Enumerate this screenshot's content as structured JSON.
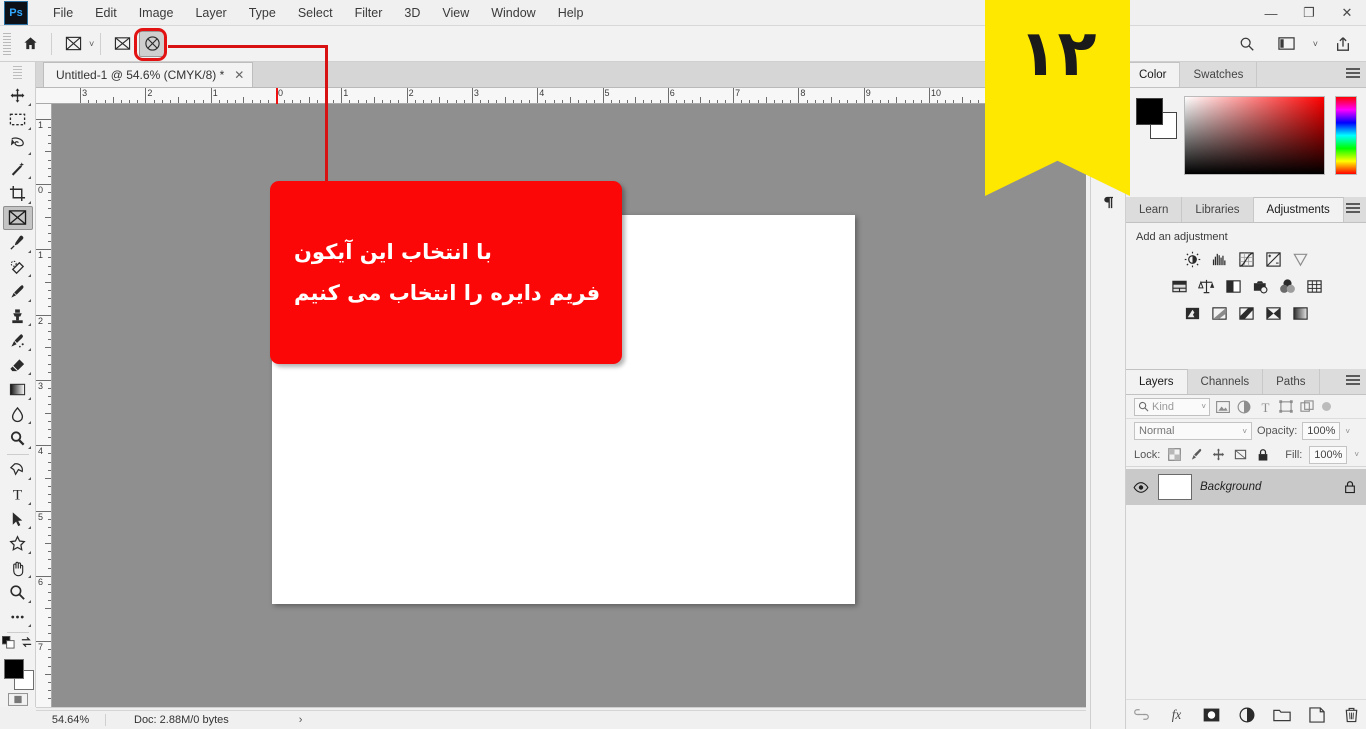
{
  "app": {
    "logo": "Ps",
    "menus": [
      "File",
      "Edit",
      "Image",
      "Layer",
      "Type",
      "Select",
      "Filter",
      "3D",
      "View",
      "Window",
      "Help"
    ],
    "window_controls": {
      "minimize": "—",
      "restore": "❐",
      "close": "✕"
    }
  },
  "options_bar": {
    "home_icon": "home-icon",
    "tool_preset_icon": "frame-tool-icon",
    "preset_caret": "˅",
    "rect_frame_icon": "rectangular-frame-icon",
    "ellipse_frame_icon": "elliptical-frame-icon",
    "search_icon": "search-icon",
    "workspace_icon": "workspace-icon",
    "workspace_caret": "˅",
    "share_icon": "share-icon"
  },
  "document_tab": {
    "title": "Untitled-1 @ 54.6% (CMYK/8) *",
    "close": "✕"
  },
  "toolbar": {
    "tools": [
      {
        "name": "move-tool",
        "glyph": "✥",
        "selected": false,
        "has_more": true
      },
      {
        "name": "marquee-tool",
        "glyph": "⬚",
        "selected": false,
        "has_more": true
      },
      {
        "name": "lasso-tool",
        "glyph": "➿",
        "selected": false,
        "has_more": true
      },
      {
        "name": "magic-wand-tool",
        "glyph": "✦",
        "selected": false,
        "has_more": true
      },
      {
        "name": "crop-tool",
        "glyph": "⌗",
        "selected": false,
        "has_more": true
      },
      {
        "name": "frame-tool",
        "glyph": "⌧",
        "selected": true,
        "has_more": false
      },
      {
        "name": "eyedropper-tool",
        "glyph": "✒",
        "selected": false,
        "has_more": true
      },
      {
        "name": "healing-brush-tool",
        "glyph": "⊘",
        "selected": false,
        "has_more": true
      },
      {
        "name": "brush-tool",
        "glyph": "✎",
        "selected": false,
        "has_more": true
      },
      {
        "name": "clone-stamp-tool",
        "glyph": "⚒",
        "selected": false,
        "has_more": true
      },
      {
        "name": "history-brush-tool",
        "glyph": "✐",
        "selected": false,
        "has_more": true
      },
      {
        "name": "eraser-tool",
        "glyph": "◰",
        "selected": false,
        "has_more": true
      },
      {
        "name": "gradient-tool",
        "glyph": "▤",
        "selected": false,
        "has_more": true
      },
      {
        "name": "blur-tool",
        "glyph": "○",
        "selected": false,
        "has_more": true
      },
      {
        "name": "dodge-tool",
        "glyph": "⚲",
        "selected": false,
        "has_more": true
      },
      {
        "name": "pen-tool",
        "glyph": "✒",
        "selected": false,
        "has_more": true
      },
      {
        "name": "type-tool",
        "glyph": "T",
        "selected": false,
        "has_more": true
      },
      {
        "name": "path-selection-tool",
        "glyph": "➤",
        "selected": false,
        "has_more": true
      },
      {
        "name": "shape-tool",
        "glyph": "★",
        "selected": false,
        "has_more": true
      },
      {
        "name": "hand-tool",
        "glyph": "✋",
        "selected": false,
        "has_more": true
      },
      {
        "name": "zoom-tool",
        "glyph": "⌕",
        "selected": false,
        "has_more": true
      },
      {
        "name": "edit-toolbar-button",
        "glyph": "⋯",
        "selected": false,
        "has_more": true
      }
    ],
    "foreground_color": "#000000",
    "background_color": "#ffffff",
    "swap_icon": "swap-colors-icon",
    "default_icon": "default-colors-icon",
    "quickmask_icon": "quick-mask-icon"
  },
  "rulers": {
    "horizontal_labels": [
      "3",
      "2",
      "1",
      "0",
      "1",
      "2",
      "3",
      "4",
      "5",
      "6",
      "7",
      "8",
      "9",
      "10"
    ],
    "vertical_labels": [
      "1",
      "0",
      "1",
      "2",
      "3",
      "4",
      "5",
      "6",
      "7"
    ],
    "guide_color": "#ee1111"
  },
  "canvas": {
    "background_color": "#8f8f8f",
    "page_color": "#ffffff"
  },
  "status_bar": {
    "zoom": "54.64%",
    "doc_info": "Doc: 2.88M/0 bytes",
    "expand_arrow": "›"
  },
  "dock_strip": {
    "paragraph_icon": "paragraph-icon",
    "expand_caret": "»"
  },
  "color_panel": {
    "tabs": [
      {
        "label": "Color",
        "active": true
      },
      {
        "label": "Swatches",
        "active": false
      }
    ],
    "menu_icon": "panel-menu-icon",
    "foreground": "#000000",
    "background": "#ffffff",
    "ramp_color": "#ff0000"
  },
  "adjustments_panel": {
    "tabs": [
      {
        "label": "Learn",
        "active": false
      },
      {
        "label": "Libraries",
        "active": false
      },
      {
        "label": "Adjustments",
        "active": true
      }
    ],
    "menu_icon": "panel-menu-icon",
    "heading": "Add an adjustment",
    "row1": [
      {
        "name": "brightness-contrast-icon",
        "glyph": "☀"
      },
      {
        "name": "levels-icon",
        "glyph": "☷"
      },
      {
        "name": "curves-icon",
        "glyph": "◱"
      },
      {
        "name": "exposure-icon",
        "glyph": "◨"
      },
      {
        "name": "vibrance-icon",
        "glyph": "▽"
      }
    ],
    "row2": [
      {
        "name": "hue-saturation-icon",
        "glyph": "▦"
      },
      {
        "name": "color-balance-icon",
        "glyph": "⚖"
      },
      {
        "name": "black-white-icon",
        "glyph": "◑"
      },
      {
        "name": "photo-filter-icon",
        "glyph": "◎"
      },
      {
        "name": "channel-mixer-icon",
        "glyph": "✽"
      },
      {
        "name": "color-lookup-icon",
        "glyph": "⊞"
      }
    ],
    "row3": [
      {
        "name": "invert-icon",
        "glyph": "◧"
      },
      {
        "name": "posterize-icon",
        "glyph": "◫"
      },
      {
        "name": "threshold-icon",
        "glyph": "◩"
      },
      {
        "name": "gradient-map-icon",
        "glyph": "⌧"
      },
      {
        "name": "selective-color-icon",
        "glyph": "▨"
      }
    ]
  },
  "layers_panel": {
    "tabs": [
      {
        "label": "Layers",
        "active": true
      },
      {
        "label": "Channels",
        "active": false
      },
      {
        "label": "Paths",
        "active": false
      }
    ],
    "menu_icon": "panel-menu-icon",
    "filter": {
      "search_icon": "search-icon",
      "kind_label": "Kind",
      "caret": "˅",
      "type_filters": [
        {
          "name": "filter-pixel-icon",
          "glyph": "▣"
        },
        {
          "name": "filter-adjustment-icon",
          "glyph": "◐"
        },
        {
          "name": "filter-type-icon",
          "glyph": "T"
        },
        {
          "name": "filter-shape-icon",
          "glyph": "⬚"
        },
        {
          "name": "filter-smart-object-icon",
          "glyph": "⧉"
        }
      ]
    },
    "blend_mode": "Normal",
    "blend_caret": "˅",
    "opacity_label": "Opacity:",
    "opacity_value": "100%",
    "opacity_caret": "˅",
    "lock_label": "Lock:",
    "lock_icons": [
      {
        "name": "lock-transparent-pixels-icon",
        "glyph": "⛶"
      },
      {
        "name": "lock-image-pixels-icon",
        "glyph": "✎"
      },
      {
        "name": "lock-position-icon",
        "glyph": "✥"
      },
      {
        "name": "lock-artboard-nesting-icon",
        "glyph": "⬚"
      },
      {
        "name": "lock-all-icon",
        "glyph": "🔒"
      }
    ],
    "fill_label": "Fill:",
    "fill_value": "100%",
    "fill_caret": "˅",
    "layers": [
      {
        "name": "Background",
        "visible_icon": "eye-icon",
        "locked_icon": "lock-icon",
        "thumb_color": "#ffffff",
        "selected": true
      }
    ],
    "footer_icons": [
      {
        "name": "link-layers-icon",
        "glyph": "⚭"
      },
      {
        "name": "layer-style-icon",
        "glyph": "fx"
      },
      {
        "name": "layer-mask-icon",
        "glyph": "◉"
      },
      {
        "name": "new-fill-adjustment-icon",
        "glyph": "◑"
      },
      {
        "name": "new-group-icon",
        "glyph": "▱"
      },
      {
        "name": "new-layer-icon",
        "glyph": "❐"
      },
      {
        "name": "delete-layer-icon",
        "glyph": "🗑"
      }
    ]
  },
  "annotation": {
    "callout_color": "#fb0707",
    "callout_text_color": "#ffffff",
    "lines": [
      "با انتخاب این آیکون",
      "فریم دایره را انتخاب می کنیم"
    ],
    "leader_color": "#d81212",
    "highlight_target": "elliptical-frame-icon"
  },
  "bookmark": {
    "number": "۱۲",
    "background_color": "#ffe800",
    "text_color": "#1a1a1a"
  }
}
